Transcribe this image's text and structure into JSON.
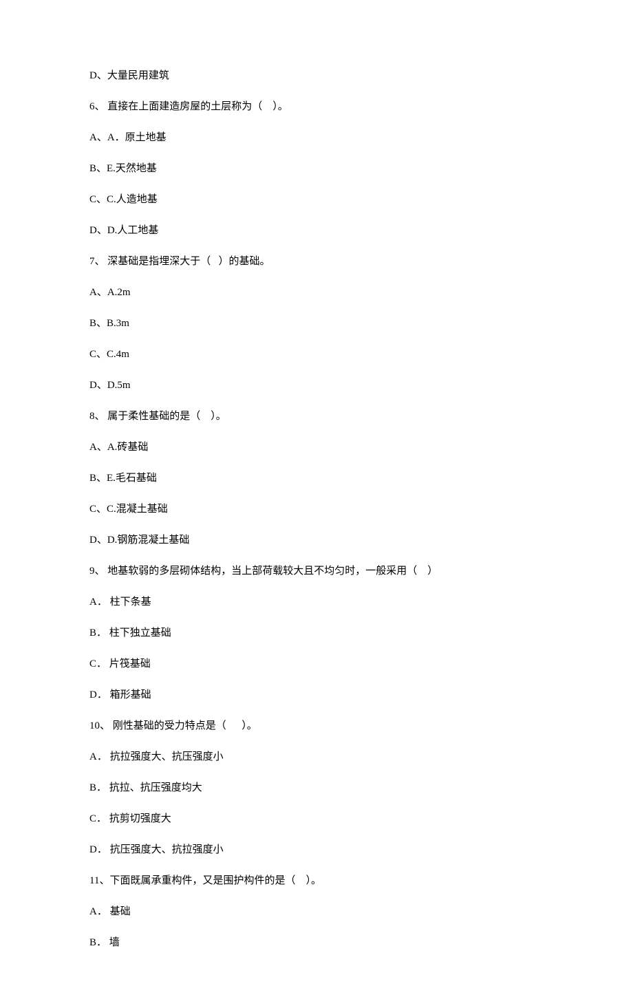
{
  "lines": [
    "D、大量民用建筑",
    "6、 直接在上面建造房屋的土层称为（    ）。",
    "A、A．原土地基",
    "B、E.天然地基",
    "C、C.人造地基",
    "D、D.人工地基",
    "7、 深基础是指埋深大于（   ）的基础。",
    "A、A.2m",
    "B、B.3m",
    "C、C.4m",
    "D、D.5m",
    "8、 属于柔性基础的是（    ）。",
    "A、A.砖基础",
    "B、E.毛石基础",
    "C、C.混凝土基础",
    "D、D.钢筋混凝土基础",
    "9、 地基软弱的多层砌体结构，当上部荷载较大且不均匀时，一般采用（    ）",
    "A． 柱下条基",
    "B． 柱下独立基础",
    "C． 片筏基础",
    "D． 箱形基础",
    "10、 刚性基础的受力特点是（      ）。",
    "A． 抗拉强度大、抗压强度小",
    "B． 抗拉、抗压强度均大",
    "C． 抗剪切强度大",
    "D． 抗压强度大、抗拉强度小",
    "11、下面既属承重构件，又是围护构件的是（    ）。",
    "A． 基础",
    "B． 墙"
  ]
}
